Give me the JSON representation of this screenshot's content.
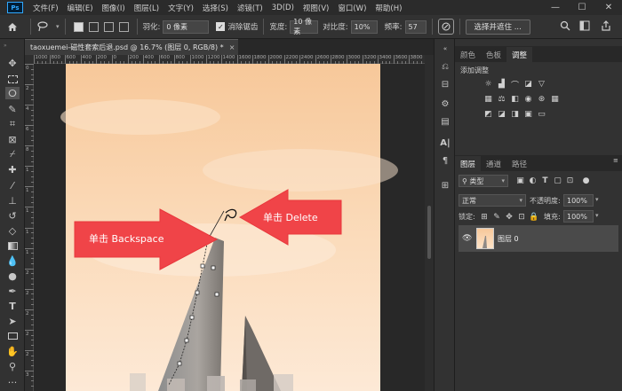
{
  "menu": [
    "文件(F)",
    "编辑(E)",
    "图像(I)",
    "图层(L)",
    "文字(Y)",
    "选择(S)",
    "滤镜(T)",
    "3D(D)",
    "视图(V)",
    "窗口(W)",
    "帮助(H)"
  ],
  "app_logo": "Ps",
  "window_controls": {
    "minimize": "—",
    "maximize": "☐",
    "close": "✕"
  },
  "options_bar": {
    "feather_label": "羽化:",
    "feather_value": "0 像素",
    "antialias_label": "消除锯齿",
    "antialias_checked": true,
    "width_label": "宽度:",
    "width_value": "10 像素",
    "contrast_label": "对比度:",
    "contrast_value": "10%",
    "frequency_label": "频率:",
    "frequency_value": "57",
    "select_subject_button": "选择并遮住 ..."
  },
  "document_tab": {
    "title": "taoxuemei-磁性套索后退.psd @ 16.7% (图层 0, RGB/8) *",
    "close": "×"
  },
  "ruler_h_ticks": [
    "1000",
    "800",
    "600",
    "400",
    "200",
    "0",
    "200",
    "400",
    "600",
    "800",
    "1000",
    "1200",
    "1400",
    "1600",
    "1800",
    "2000",
    "2200",
    "2400",
    "2600",
    "2800",
    "3000",
    "3200",
    "3400",
    "3600",
    "3800"
  ],
  "ruler_v_ticks": [
    "0",
    "2",
    "4",
    "6",
    "8",
    "1",
    "1",
    "1",
    "1",
    "1",
    "2",
    "2",
    "2",
    "2",
    "2",
    "3"
  ],
  "annotations": {
    "backspace": "单击 Backspace",
    "delete": "单击 Delete"
  },
  "colors": {
    "arrow_red": "#f04448",
    "sky_top": "#f7c89a",
    "sky_bottom": "#fbe6cf",
    "accent": "#31a8ff"
  },
  "panel_top": {
    "tabs": [
      "颜色",
      "色板",
      "调整"
    ],
    "active_tab": "调整",
    "add_adjustment_label": "添加调整"
  },
  "layers_panel": {
    "tabs": [
      "图层",
      "通道",
      "路径"
    ],
    "active_tab": "图层",
    "filter_kind": "类型",
    "blend_mode": "正常",
    "opacity_label": "不透明度:",
    "opacity_value": "100%",
    "lock_label": "锁定:",
    "fill_label": "填充:",
    "fill_value": "100%",
    "layer_name": "图层 0"
  }
}
